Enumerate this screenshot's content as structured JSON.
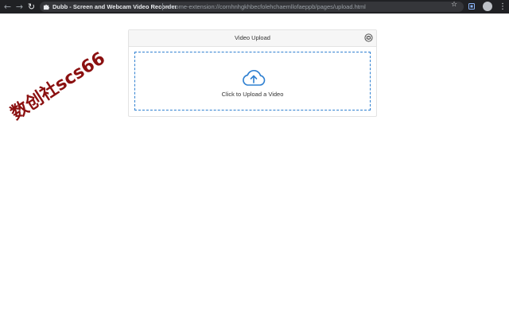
{
  "browser": {
    "tab_title": "Dubb - Screen and Webcam Video Recorder",
    "url": "chrome-extension://cornhnhgkhbecfolehchaemllofaeppb/pages/upload.html",
    "icons": {
      "back": "back-arrow-icon",
      "forward": "forward-arrow-icon",
      "reload": "reload-icon",
      "star": "bookmark-star-icon",
      "menu": "more-vert-icon"
    }
  },
  "upload": {
    "title": "Video Upload",
    "dropzone_label": "Click to Upload a Video",
    "accent_color": "#2f80d1"
  },
  "watermark": {
    "text": "数创社scs66"
  }
}
